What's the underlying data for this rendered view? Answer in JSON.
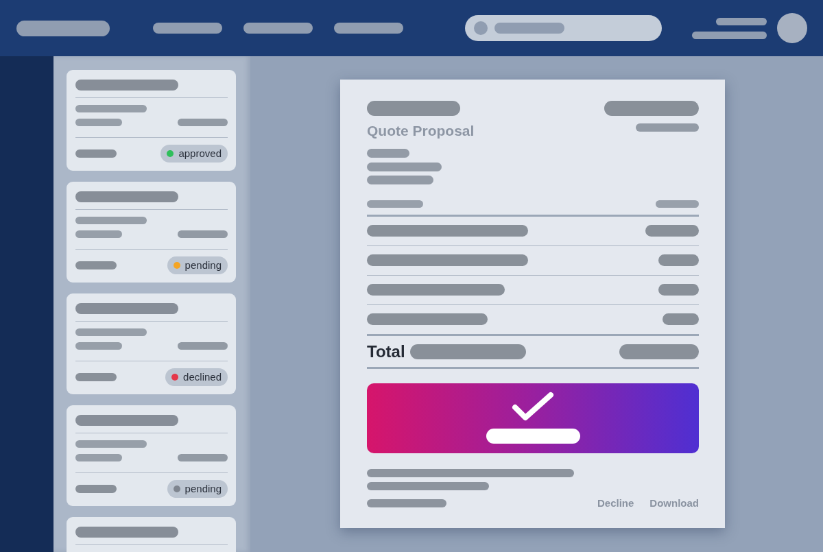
{
  "cards": [
    {
      "kind": "status",
      "status": "approved",
      "color": "#2fbf5b"
    },
    {
      "kind": "status",
      "status": "pending",
      "color": "#f5a524"
    },
    {
      "kind": "status",
      "status": "declined",
      "color": "#e5384a"
    },
    {
      "kind": "status",
      "status": "pending",
      "color": "#7e858f"
    },
    {
      "kind": "plain"
    }
  ],
  "document": {
    "title": "Quote Proposal",
    "total_label": "Total",
    "actions": [
      "Decline",
      "Download"
    ]
  }
}
